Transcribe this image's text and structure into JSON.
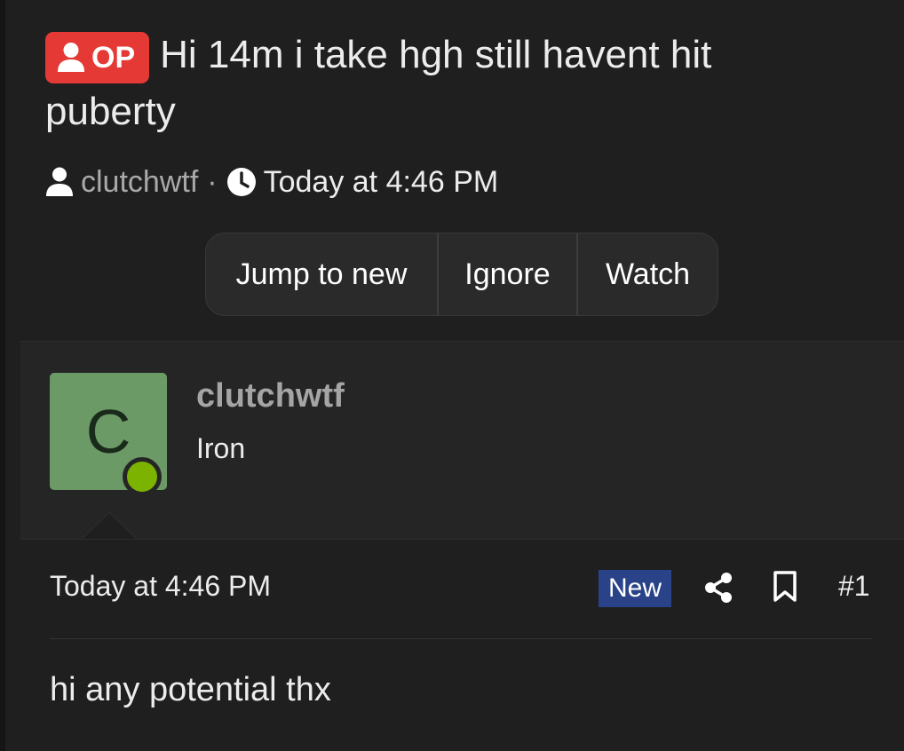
{
  "thread": {
    "op_label": "OP",
    "title": "Hi 14m i take hgh still havent hit puberty",
    "author": "clutchwtf",
    "separator": "·",
    "date": "Today at 4:46 PM"
  },
  "actions": {
    "jump_to_new": "Jump to new",
    "ignore": "Ignore",
    "watch": "Watch"
  },
  "post": {
    "avatar_letter": "C",
    "username": "clutchwtf",
    "user_title": "Iron",
    "date": "Today at 4:46 PM",
    "new_badge": "New",
    "post_number": "#1",
    "body": "hi any potential thx",
    "online": true
  },
  "icons": {
    "op": "user-icon",
    "author": "user-icon",
    "date": "clock-icon",
    "share": "share-icon",
    "bookmark": "bookmark-icon"
  },
  "colors": {
    "background": "#1f1f1f",
    "op_badge": "#e53935",
    "new_badge": "#2a4388",
    "avatar": "#6b9a67",
    "online": "#7cb300"
  }
}
